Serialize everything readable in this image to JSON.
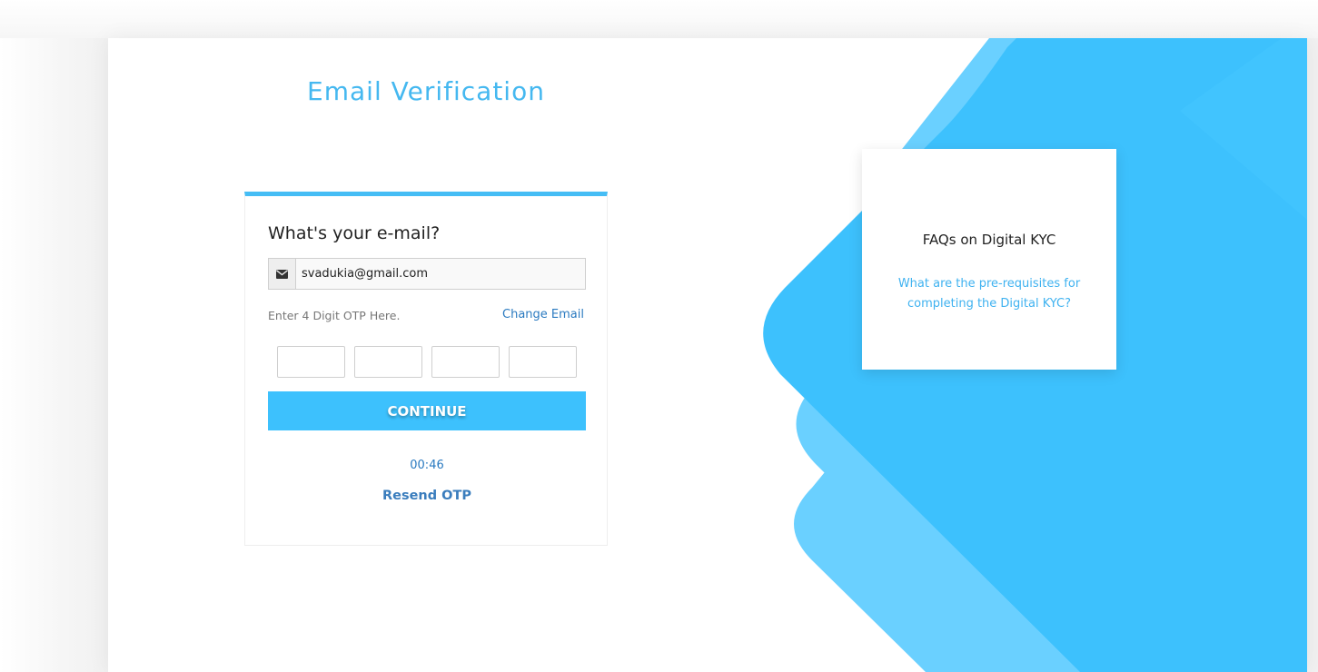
{
  "page": {
    "title": "Email Verification"
  },
  "form": {
    "question": "What's your e-mail?",
    "email_value": "svadukia@gmail.com",
    "email_icon": "envelope-icon",
    "otp_label": "Enter 4 Digit OTP Here.",
    "change_email_label": "Change Email",
    "otp_digits": [
      "",
      "",
      "",
      ""
    ],
    "continue_label": "CONTINUE",
    "timer": "00:46",
    "resend_label": "Resend OTP"
  },
  "faq": {
    "title": "FAQs on Digital KYC",
    "question_link": "What are the pre-requisites for completing the Digital KYC?"
  },
  "colors": {
    "accent": "#3dc1fd",
    "accent_light": "#6ad0ff",
    "title": "#45b8f0",
    "link": "#2a7ac0"
  }
}
